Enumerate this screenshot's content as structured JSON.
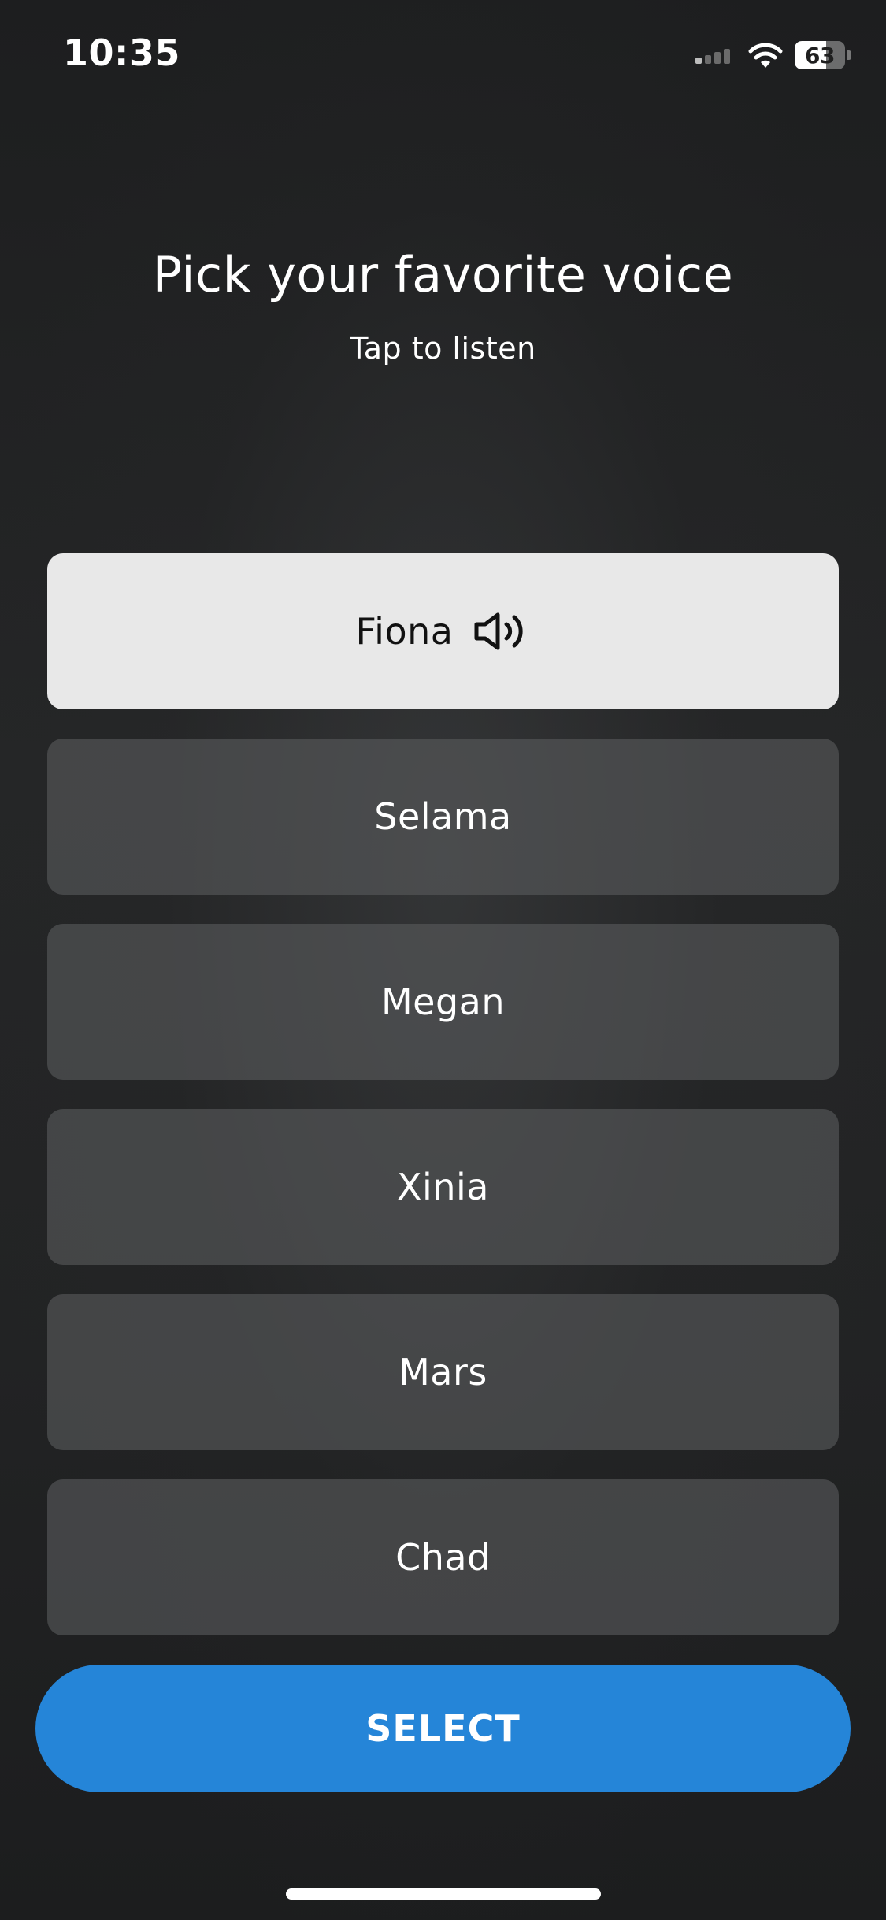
{
  "status_bar": {
    "time": "10:35",
    "battery_level": "63",
    "battery_fraction": 0.63,
    "signal_bars_active": 1,
    "signal_bars_total": 4,
    "icons": [
      "cellular-signal-icon",
      "wifi-icon",
      "battery-icon"
    ]
  },
  "header": {
    "title": "Pick your favorite voice",
    "subtitle": "Tap to listen"
  },
  "voices": [
    {
      "label": "Fiona",
      "selected": true,
      "icon": "speaker-icon"
    },
    {
      "label": "Selama",
      "selected": false
    },
    {
      "label": "Megan",
      "selected": false
    },
    {
      "label": "Xinia",
      "selected": false
    },
    {
      "label": "Mars",
      "selected": false
    },
    {
      "label": "Chad",
      "selected": false
    }
  ],
  "actions": {
    "select_label": "SELECT"
  },
  "colors": {
    "background": "#1f2021",
    "option_bg": "#585a5c",
    "option_selected_bg": "#e8e8e8",
    "accent": "#2585d8",
    "text": "#ffffff"
  }
}
